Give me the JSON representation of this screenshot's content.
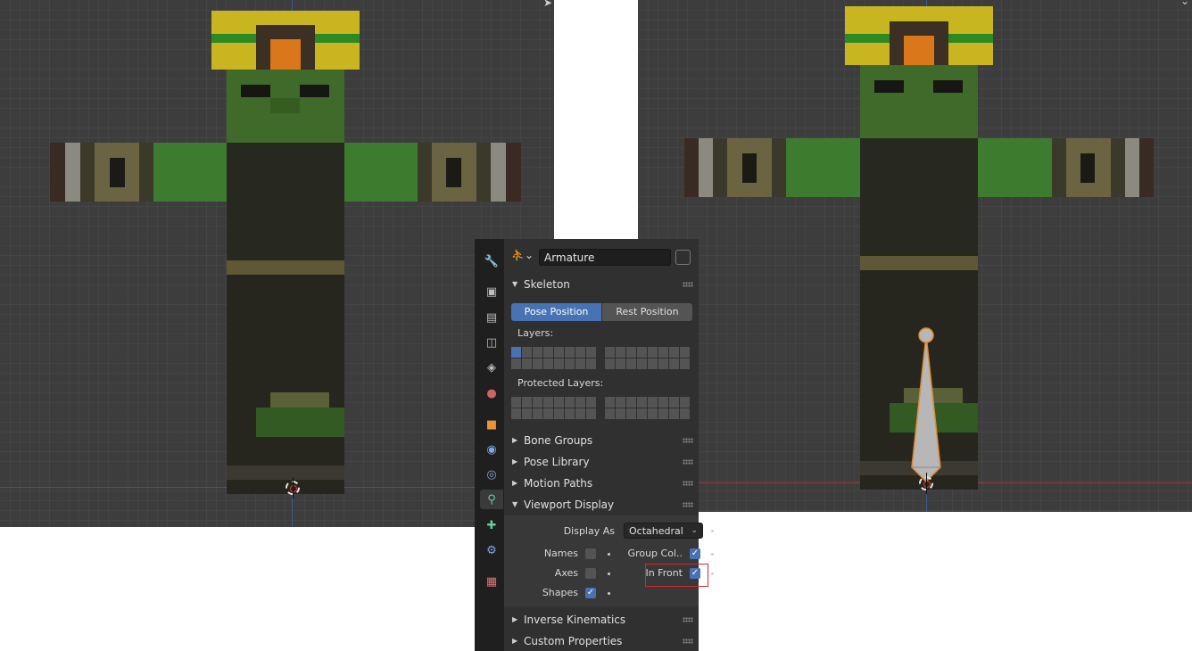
{
  "properties": {
    "armature_name": "Armature",
    "skeleton": {
      "title": "Skeleton",
      "pose_position_label": "Pose Position",
      "rest_position_label": "Rest Position",
      "layers_label": "Layers:",
      "protected_layers_label": "Protected Layers:"
    },
    "panels": {
      "bone_groups": "Bone Groups",
      "pose_library": "Pose Library",
      "motion_paths": "Motion Paths",
      "viewport_display": "Viewport Display",
      "inverse_kinematics": "Inverse Kinematics",
      "custom_properties": "Custom Properties"
    },
    "viewport_display": {
      "display_as_label": "Display As",
      "display_as_value": "Octahedral",
      "names_label": "Names",
      "names_checked": false,
      "axes_label": "Axes",
      "axes_checked": false,
      "shapes_label": "Shapes",
      "shapes_checked": true,
      "group_colors_label": "Group Col..",
      "group_colors_checked": true,
      "in_front_label": "In Front",
      "in_front_checked": true
    },
    "tabs": [
      "tool-icon",
      "render-icon",
      "output-icon",
      "view-layer-icon",
      "scene-icon",
      "world-icon",
      "object-icon",
      "modifier-icon",
      "physics-icon",
      "object-data-armature-icon",
      "bone-icon",
      "bone-constraint-icon",
      "texture-icon"
    ],
    "active_tab": "object-data-armature-icon"
  },
  "colors": {
    "accent": "#4772b3",
    "highlight": "#d42a2a",
    "viewport_bg": "#3d3d3d"
  }
}
